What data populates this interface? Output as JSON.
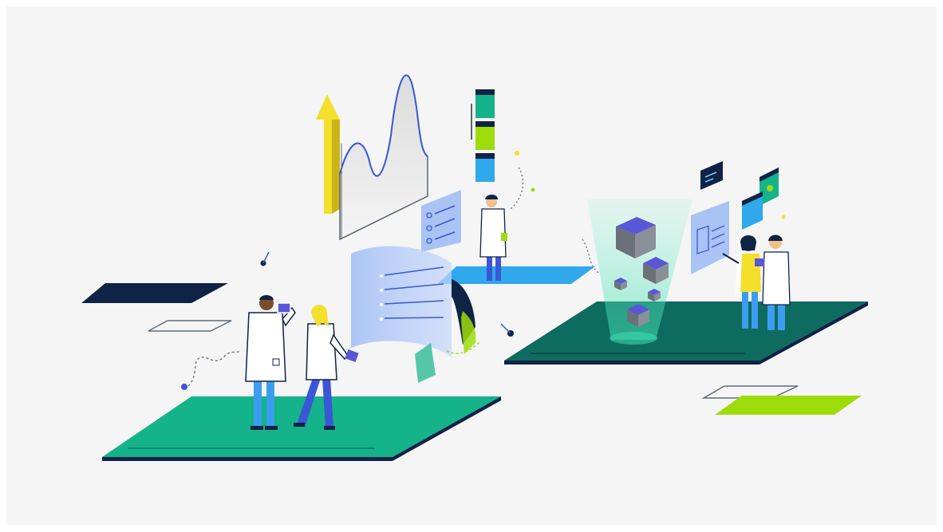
{
  "palette": {
    "background": "#f5f5f6",
    "frame": "#ffffff",
    "teal": "#14b38a",
    "teal_dark": "#0e6b60",
    "navy": "#0f2346",
    "blue": "#3b9df0",
    "blue_light": "#a9c3f5",
    "lime": "#9ddc0a",
    "yellow": "#f3df2c",
    "grey_cube": "#8b8f98",
    "purple": "#5a57d6",
    "mint_glow": "#7ff0c9"
  },
  "icons": {
    "scientist": "scientist-icon",
    "cube": "cube-icon",
    "chart": "chart-icon",
    "arrow": "arrow-up-icon",
    "card": "card-icon"
  }
}
